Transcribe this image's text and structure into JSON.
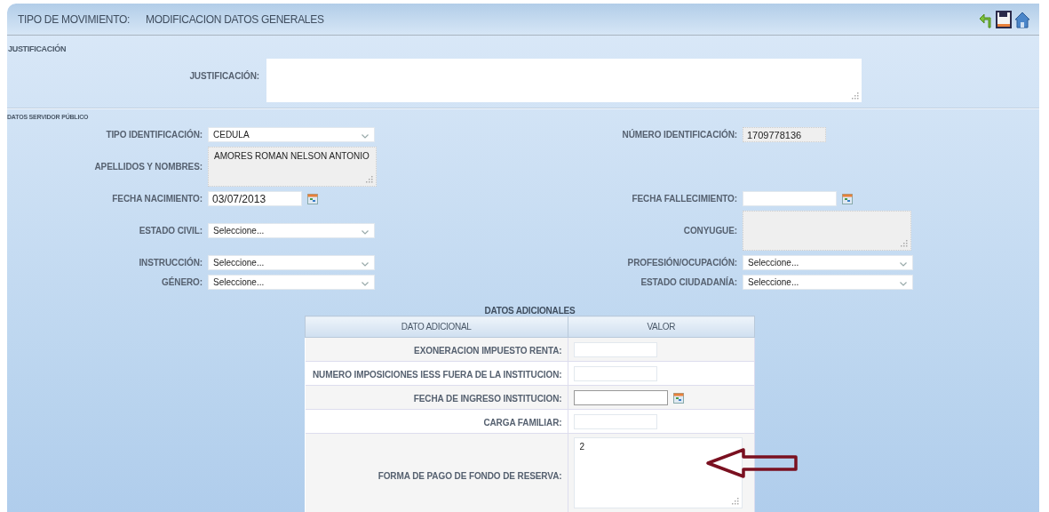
{
  "header": {
    "label": "TIPO DE MOVIMIENTO:",
    "title": "MODIFICACION DATOS GENERALES",
    "actions": [
      {
        "kind": "back"
      },
      {
        "kind": "save"
      },
      {
        "kind": "home"
      }
    ]
  },
  "justification": {
    "heading": "JUSTIFICACIÓN",
    "field": {
      "label": "JUSTIFICACIÓN:",
      "kind": "textarea",
      "readonly": false
    }
  },
  "server": {
    "heading": "DATOS SERVIDOR PÚBLICO",
    "rows": [
      {
        "left": {
          "label": "TIPO IDENTIFICACIÓN:",
          "kind": "select",
          "value": "CEDULA",
          "readonly": false
        },
        "right": {
          "label": "NÚMERO IDENTIFICACIÓN:",
          "kind": "text",
          "value": "1709778136",
          "readonly": true
        }
      },
      {
        "left": {
          "label": "APELLIDOS Y NOMBRES:",
          "kind": "textarea",
          "value": "AMORES ROMAN NELSON ANTONIO",
          "readonly": true
        }
      },
      {
        "left": {
          "label": "FECHA NACIMIENTO:",
          "kind": "date",
          "value": "03/07/2013",
          "readonly": false
        },
        "right": {
          "label": "FECHA FALLECIMIENTO:",
          "kind": "date",
          "readonly": false
        }
      },
      {
        "left": {
          "label": "ESTADO CIVIL:",
          "kind": "select",
          "value": "Seleccione...",
          "readonly": false
        },
        "right": {
          "label": "CONYUGUE:",
          "kind": "textarea",
          "readonly": true
        }
      },
      {
        "left": {
          "label": "INSTRUCCIÓN:",
          "kind": "select",
          "value": "Seleccione...",
          "readonly": false
        },
        "right": {
          "label": "PROFESIÓN/OCUPACIÓN:",
          "kind": "select",
          "value": "Seleccione...",
          "readonly": false
        }
      },
      {
        "left": {
          "label": "GÉNERO:",
          "kind": "select",
          "value": "Seleccione...",
          "readonly": false
        },
        "right": {
          "label": "ESTADO CIUDADANÍA:",
          "kind": "select",
          "value": "Seleccione...",
          "readonly": false
        }
      }
    ]
  },
  "additional": {
    "title": "DATOS ADICIONALES",
    "columns": [
      "DATO ADICIONAL",
      "VALOR"
    ],
    "rows": [
      {
        "label": "EXONERACION IMPUESTO RENTA:",
        "kind": "text",
        "readonly": false
      },
      {
        "label": "NUMERO IMPOSICIONES IESS FUERA DE LA INSTITUCION:",
        "kind": "text",
        "readonly": false
      },
      {
        "label": "FECHA DE INGRESO INSTITUCION:",
        "kind": "date",
        "readonly": false
      },
      {
        "label": "CARGA FAMILIAR:",
        "kind": "text",
        "readonly": false
      },
      {
        "label": "FORMA DE PAGO DE FONDO DE RESERVA:",
        "kind": "textarea",
        "value": "2",
        "readonly": false
      }
    ],
    "annotation": {
      "kind": "arrow"
    }
  }
}
